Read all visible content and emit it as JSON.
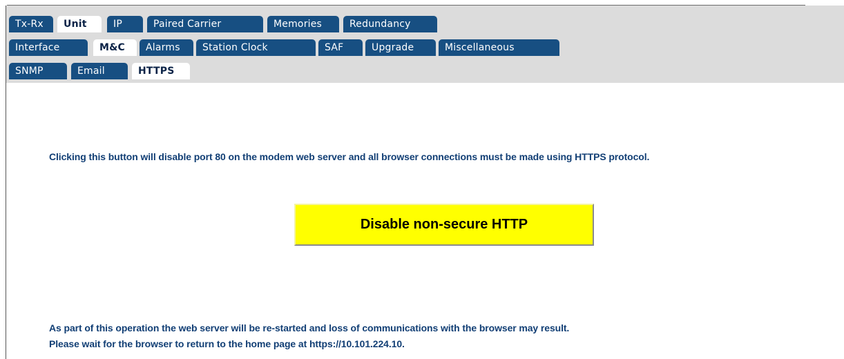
{
  "tabs": {
    "row1": [
      {
        "label": "Tx-Rx",
        "active": false
      },
      {
        "label": "Unit",
        "active": true
      },
      {
        "label": "IP",
        "active": false
      },
      {
        "label": "Paired Carrier",
        "active": false
      },
      {
        "label": "Memories",
        "active": false
      },
      {
        "label": "Redundancy",
        "active": false
      }
    ],
    "row2": [
      {
        "label": "Interface",
        "active": false
      },
      {
        "label": "M&C",
        "active": true
      },
      {
        "label": "Alarms",
        "active": false
      },
      {
        "label": "Station Clock",
        "active": false
      },
      {
        "label": "SAF",
        "active": false
      },
      {
        "label": "Upgrade",
        "active": false
      },
      {
        "label": "Miscellaneous",
        "active": false
      }
    ],
    "row3": [
      {
        "label": "SNMP",
        "active": false
      },
      {
        "label": "Email",
        "active": false
      },
      {
        "label": "HTTPS",
        "active": true
      }
    ]
  },
  "content": {
    "info_text": "Clicking this button will disable port 80 on the modem web server and all browser connections must be made using HTTPS protocol.",
    "button_label": "Disable non-secure HTTP",
    "note_line1": "As part of this operation the web server will be re-started and loss of communications with the browser may result.",
    "note_line2": "Please wait for the browser to return to the home page at https://10.101.224.10."
  },
  "colors": {
    "tab_background": "#174f82",
    "tab_active_background": "#ffffff",
    "header_background": "#dcdcdc",
    "message_text": "#123f75",
    "button_background": "#ffff00"
  }
}
